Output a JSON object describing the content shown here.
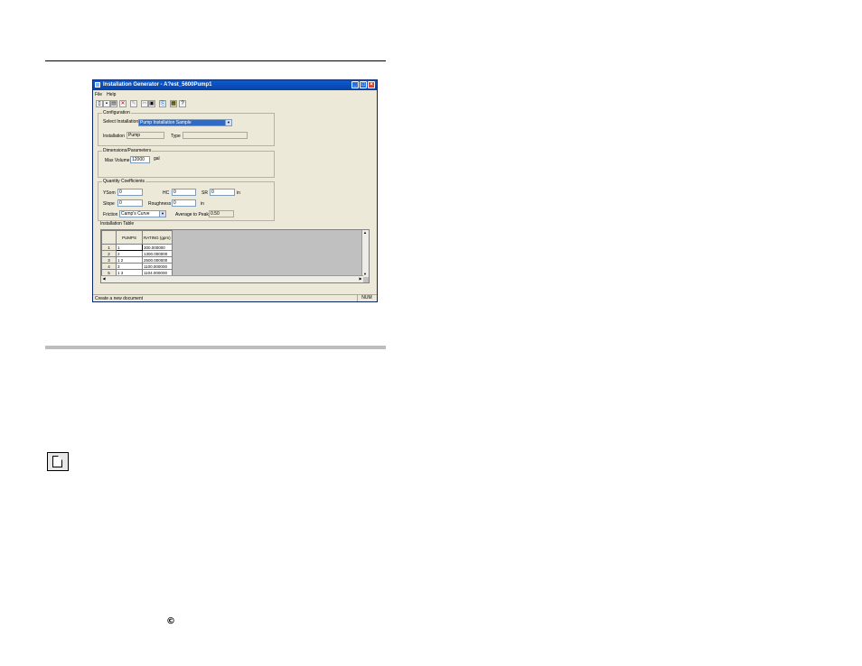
{
  "window": {
    "title": "Installation Generator - A?est_5600Pump1",
    "menu": [
      "File",
      "Help"
    ]
  },
  "toolbar": {
    "icons": [
      "new-icon",
      "save-icon",
      "print-icon",
      "delete-icon",
      "edit-icon",
      "cut-icon",
      "copy-icon",
      "paste-icon",
      "calculator-icon",
      "help-icon"
    ]
  },
  "configuration": {
    "group_label": "Configuration",
    "select_label": "Select Installation",
    "select_value": "Pump Installation Sample",
    "installation_label": "Installation",
    "installation_value": "Pump",
    "type_label": "Type",
    "type_value": ""
  },
  "dimensions": {
    "group_label": "Dimensions/Parameters",
    "max_volume_label": "Max Volume",
    "max_volume_value": "12000",
    "max_volume_unit": "gal"
  },
  "quantity": {
    "group_label": "Quantity Coefficients",
    "ysom_label": "YSom",
    "ysom_value": "0",
    "hc_label": "HC",
    "hc_value": "0",
    "sr_label": "SR",
    "sr_value": "0",
    "sr_unit": "in",
    "slope_label": "Slope",
    "slope_value": "0",
    "roughness_label": "Roughness",
    "roughness_value": "0",
    "roughness_unit": "in",
    "friction_label": "Friction Factor",
    "friction_value": "Camp's Curve",
    "avg_peak_label": "Average to Peak",
    "avg_peak_value": "0.50"
  },
  "table": {
    "group_label": "Installation Table",
    "headers": [
      "PUMPS",
      "RATING (gpm)"
    ],
    "rows": [
      {
        "n": "1",
        "pumps": "1",
        "rating": "300.000000"
      },
      {
        "n": "2",
        "pumps": "2",
        "rating": "1300.000000"
      },
      {
        "n": "3",
        "pumps": "1 2",
        "rating": "2500.000000"
      },
      {
        "n": "4",
        "pumps": "3",
        "rating": "1100.000000"
      },
      {
        "n": "5",
        "pumps": "1 3",
        "rating": "1104.000000"
      }
    ]
  },
  "status": {
    "text": "Create a new document",
    "mode": "NUM"
  },
  "page": {
    "copyright": "©"
  }
}
